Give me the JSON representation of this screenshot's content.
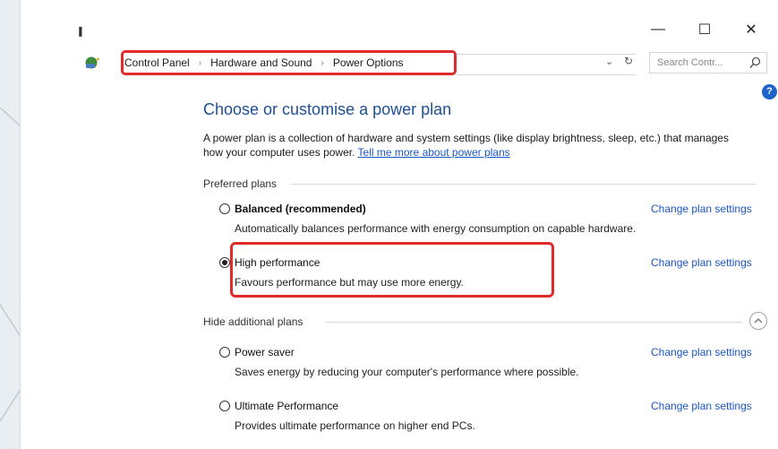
{
  "window": {
    "title_glyph": "▐",
    "minimize_label": "—",
    "maximize_label": "☐",
    "close_label": "✕"
  },
  "address": {
    "breadcrumbs": [
      "Control Panel",
      "Hardware and Sound",
      "Power Options"
    ],
    "search_placeholder": "Search Contr...",
    "icons": [
      "control-panel-icon",
      "dropdown-arrow-icon",
      "refresh-icon",
      "search-icon"
    ]
  },
  "help_label": "?",
  "main": {
    "heading": "Choose or customise a power plan",
    "description": "A power plan is a collection of hardware and system settings (like display brightness, sleep, etc.) that manages how your computer uses power.",
    "learn_more_link": "Tell me more about power plans",
    "preferred_label": "Preferred plans",
    "hidden_label": "Hide additional plans",
    "change_settings_label": "Change plan settings",
    "preferred_plans": [
      {
        "name": "Balanced (recommended)",
        "description": "Automatically balances performance with energy consumption on capable hardware.",
        "selected": false,
        "bold": true
      },
      {
        "name": "High performance",
        "description": "Favours performance but may use more energy.",
        "selected": true,
        "bold": false
      }
    ],
    "additional_plans": [
      {
        "name": "Power saver",
        "description": "Saves energy by reducing your computer's performance where possible.",
        "selected": false
      },
      {
        "name": "Ultimate Performance",
        "description": "Provides ultimate performance on higher end PCs.",
        "selected": false
      }
    ]
  },
  "colors": {
    "highlight_box": "#e02b2b",
    "heading": "#1e4f95",
    "link": "#1a56c4"
  }
}
